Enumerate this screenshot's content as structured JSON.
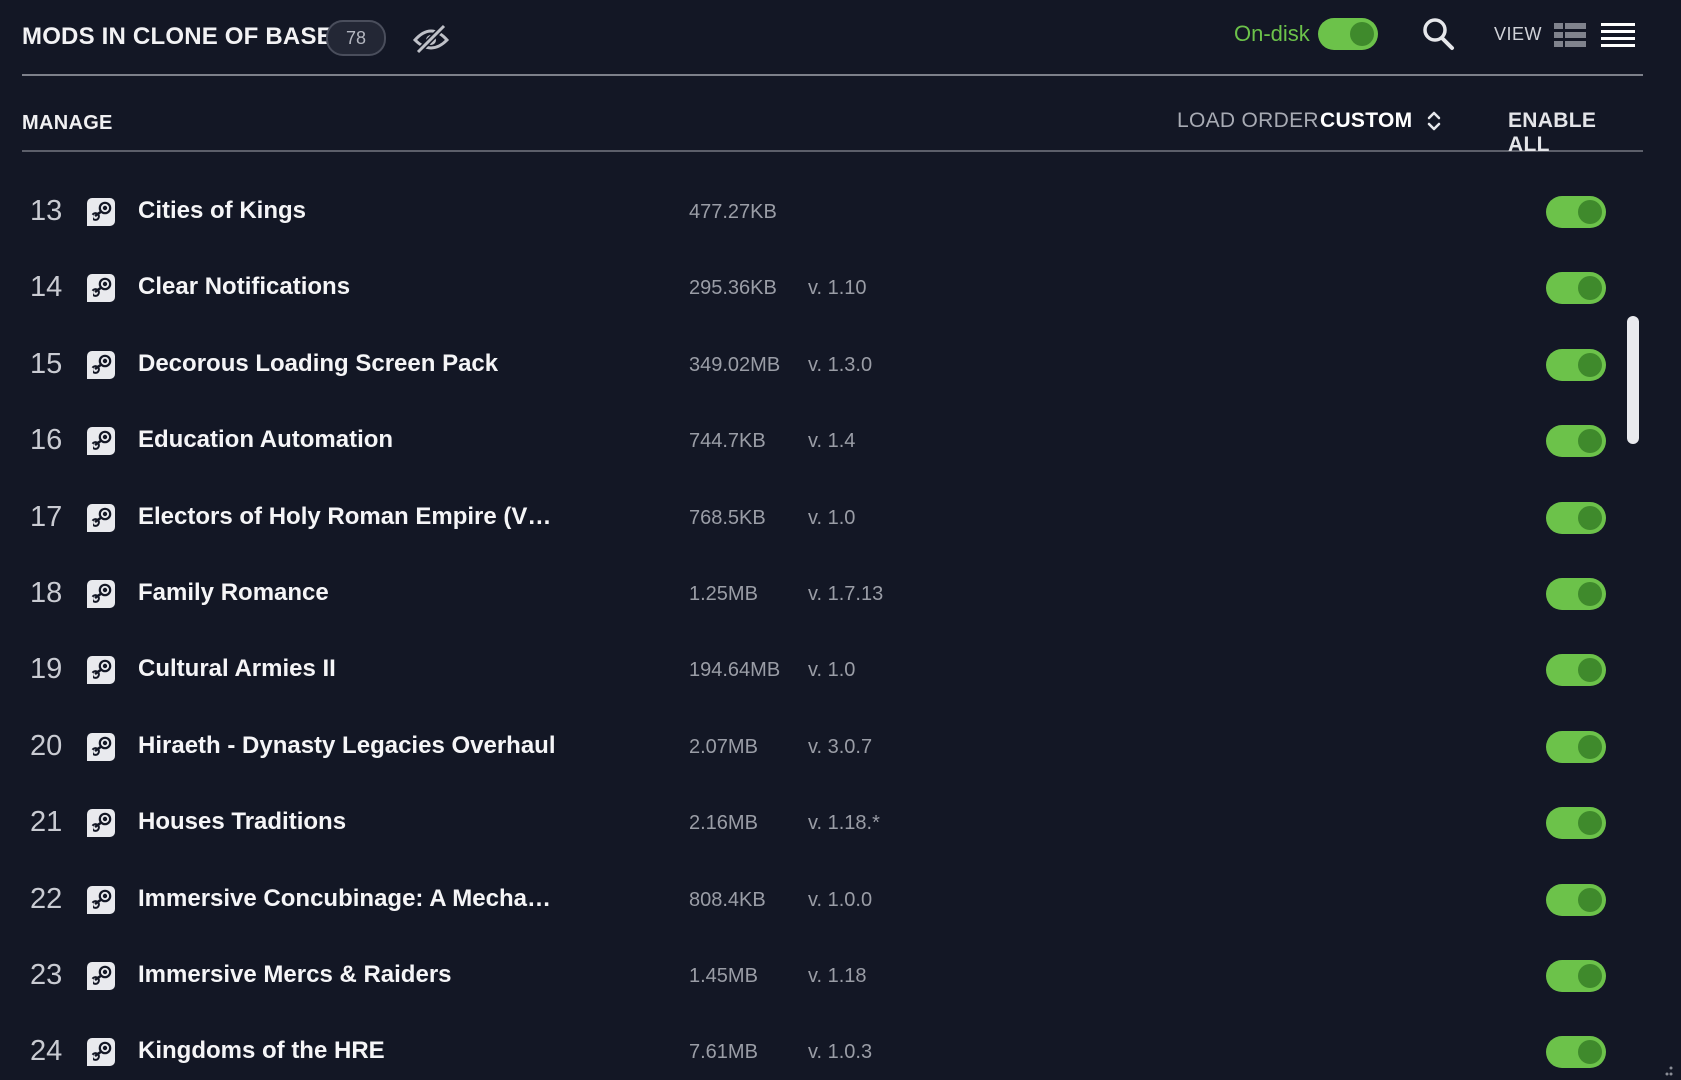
{
  "header": {
    "title": "MODS IN CLONE OF BASE",
    "count": "78",
    "on_disk_label": "On-disk",
    "on_disk_enabled": true,
    "view_label": "VIEW"
  },
  "manage": {
    "label": "MANAGE",
    "load_order_label": "LOAD ORDER",
    "load_order_value": "CUSTOM",
    "enable_all_label": "ENABLE ALL"
  },
  "mods": [
    {
      "index": "13",
      "name": "Cities of Kings",
      "size": "477.27KB",
      "version": "",
      "enabled": true
    },
    {
      "index": "14",
      "name": "Clear Notifications",
      "size": "295.36KB",
      "version": "v. 1.10",
      "enabled": true
    },
    {
      "index": "15",
      "name": "Decorous Loading Screen Pack",
      "size": "349.02MB",
      "version": "v. 1.3.0",
      "enabled": true
    },
    {
      "index": "16",
      "name": "Education Automation",
      "size": "744.7KB",
      "version": "v. 1.4",
      "enabled": true
    },
    {
      "index": "17",
      "name": "Electors of Holy Roman Empire (V…",
      "size": "768.5KB",
      "version": "v. 1.0",
      "enabled": true
    },
    {
      "index": "18",
      "name": "Family Romance",
      "size": "1.25MB",
      "version": "v. 1.7.13",
      "enabled": true
    },
    {
      "index": "19",
      "name": "Cultural Armies II",
      "size": "194.64MB",
      "version": "v. 1.0",
      "enabled": true
    },
    {
      "index": "20",
      "name": "Hiraeth - Dynasty Legacies Overhaul",
      "size": "2.07MB",
      "version": "v. 3.0.7",
      "enabled": true
    },
    {
      "index": "21",
      "name": "Houses Traditions",
      "size": "2.16MB",
      "version": "v. 1.18.*",
      "enabled": true
    },
    {
      "index": "22",
      "name": "Immersive Concubinage: A Mecha…",
      "size": "808.4KB",
      "version": "v. 1.0.0",
      "enabled": true
    },
    {
      "index": "23",
      "name": "Immersive Mercs & Raiders",
      "size": "1.45MB",
      "version": "v. 1.18",
      "enabled": true
    },
    {
      "index": "24",
      "name": "Kingdoms of the HRE",
      "size": "7.61MB",
      "version": "v. 1.0.3",
      "enabled": true
    }
  ],
  "icons": {
    "hidden": "eye-slash-icon",
    "search": "search-icon",
    "grid_view": "grid-view-icon",
    "list_view": "list-view-icon",
    "sort": "sort-icon",
    "mod_source": "steam-icon"
  },
  "colors": {
    "background": "#131725",
    "accent_green": "#6cc24a",
    "toggle_knob": "#3f8a2c",
    "muted_text": "#9a9da6"
  }
}
